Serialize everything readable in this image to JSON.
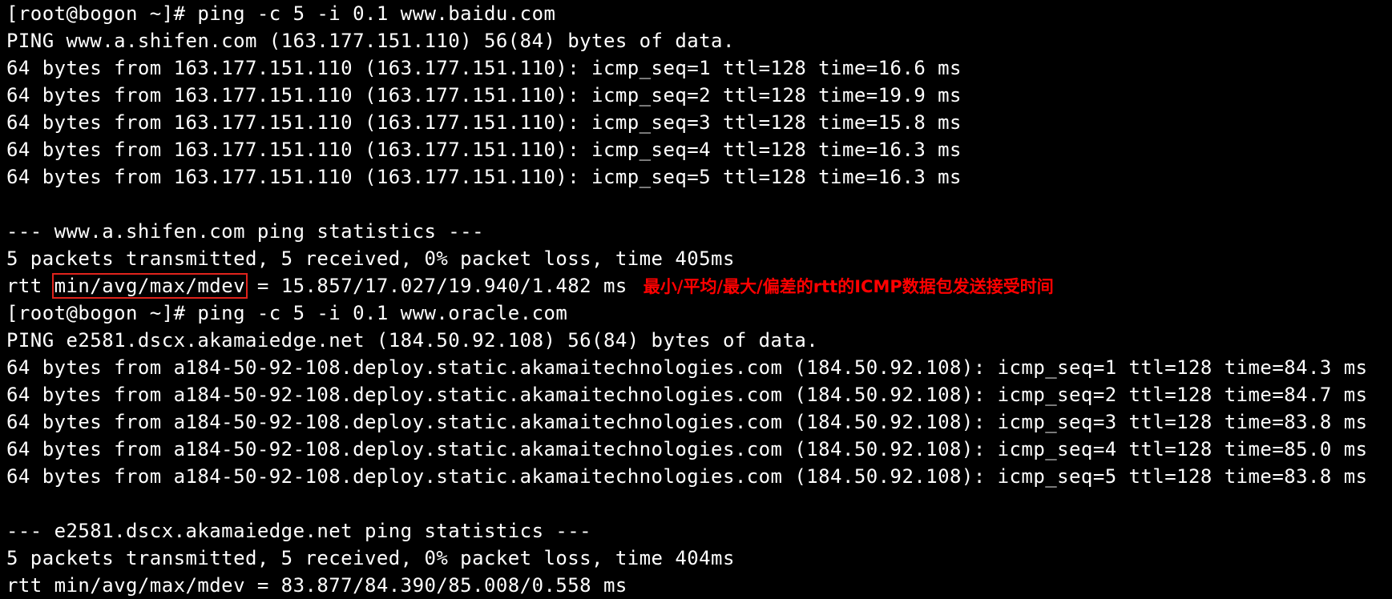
{
  "theme": {
    "background": "#000000",
    "foreground": "#ffffff",
    "annotation": "#ff0000",
    "box": "#e0231c"
  },
  "lines": [
    "[root@bogon ~]# ping -c 5 -i 0.1 www.baidu.com",
    "PING www.a.shifen.com (163.177.151.110) 56(84) bytes of data.",
    "64 bytes from 163.177.151.110 (163.177.151.110): icmp_seq=1 ttl=128 time=16.6 ms",
    "64 bytes from 163.177.151.110 (163.177.151.110): icmp_seq=2 ttl=128 time=19.9 ms",
    "64 bytes from 163.177.151.110 (163.177.151.110): icmp_seq=3 ttl=128 time=15.8 ms",
    "64 bytes from 163.177.151.110 (163.177.151.110): icmp_seq=4 ttl=128 time=16.3 ms",
    "64 bytes from 163.177.151.110 (163.177.151.110): icmp_seq=5 ttl=128 time=16.3 ms",
    "",
    "--- www.a.shifen.com ping statistics ---",
    "5 packets transmitted, 5 received, 0% packet loss, time 405ms",
    "",
    "[root@bogon ~]# ping -c 5 -i 0.1 www.oracle.com",
    "PING e2581.dscx.akamaiedge.net (184.50.92.108) 56(84) bytes of data.",
    "64 bytes from a184-50-92-108.deploy.static.akamaitechnologies.com (184.50.92.108): icmp_seq=1 ttl=128 time=84.3 ms",
    "64 bytes from a184-50-92-108.deploy.static.akamaitechnologies.com (184.50.92.108): icmp_seq=2 ttl=128 time=84.7 ms",
    "64 bytes from a184-50-92-108.deploy.static.akamaitechnologies.com (184.50.92.108): icmp_seq=3 ttl=128 time=83.8 ms",
    "64 bytes from a184-50-92-108.deploy.static.akamaitechnologies.com (184.50.92.108): icmp_seq=4 ttl=128 time=85.0 ms",
    "64 bytes from a184-50-92-108.deploy.static.akamaitechnologies.com (184.50.92.108): icmp_seq=5 ttl=128 time=83.8 ms",
    "",
    "--- e2581.dscx.akamaiedge.net ping statistics ---",
    "5 packets transmitted, 5 received, 0% packet loss, time 404ms",
    "rtt min/avg/max/mdev = 83.877/84.390/85.008/0.558 ms"
  ],
  "rtt_line": {
    "prefix": "rtt ",
    "boxed": "min/avg/max/mdev",
    "suffix": " = 15.857/17.027/19.940/1.482 ms",
    "annotation": "最小/平均/最大/偏差的rtt的ICMP数据包发送接受时间"
  }
}
